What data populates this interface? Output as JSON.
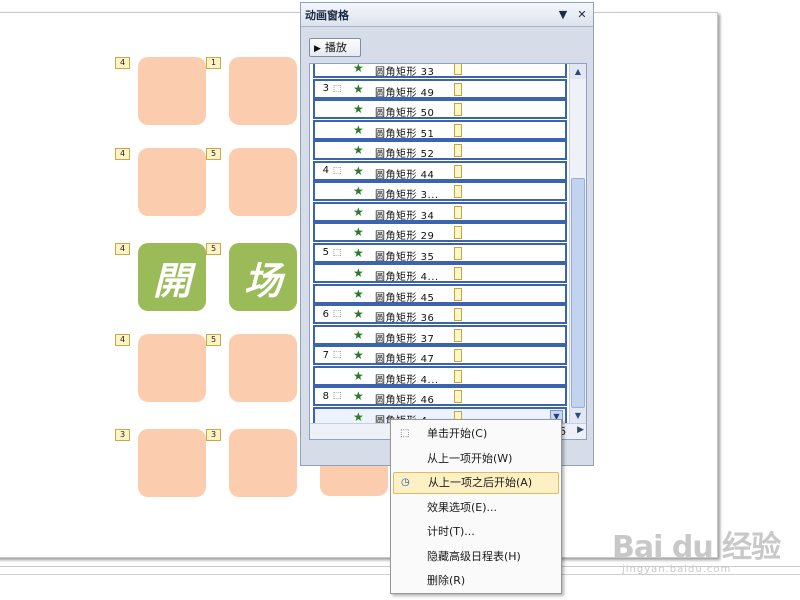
{
  "slide": {
    "badges": [
      "4",
      "1",
      "4",
      "5",
      "4",
      "5",
      "4",
      "5",
      "3",
      "3"
    ],
    "green_tiles": [
      "開",
      "场"
    ]
  },
  "pane": {
    "title": "动画窗格",
    "dropdown_arrow": "▼",
    "close": "✕",
    "play_label": "播放",
    "rows": [
      {
        "num": "",
        "label": "圆角矩形 33",
        "mouse": false
      },
      {
        "num": "3",
        "label": "圆角矩形 49",
        "mouse": true
      },
      {
        "num": "",
        "label": "圆角矩形 50",
        "mouse": false
      },
      {
        "num": "",
        "label": "圆角矩形 51",
        "mouse": false
      },
      {
        "num": "",
        "label": "圆角矩形 52",
        "mouse": false
      },
      {
        "num": "4",
        "label": "圆角矩形 44",
        "mouse": true
      },
      {
        "num": "",
        "label": "圆角矩形 3...",
        "mouse": false
      },
      {
        "num": "",
        "label": "圆角矩形 34",
        "mouse": false
      },
      {
        "num": "",
        "label": "圆角矩形 29",
        "mouse": false
      },
      {
        "num": "5",
        "label": "圆角矩形 35",
        "mouse": true
      },
      {
        "num": "",
        "label": "圆角矩形 4...",
        "mouse": false
      },
      {
        "num": "",
        "label": "圆角矩形 45",
        "mouse": false
      },
      {
        "num": "6",
        "label": "圆角矩形 36",
        "mouse": true
      },
      {
        "num": "",
        "label": "圆角矩形 37",
        "mouse": false
      },
      {
        "num": "7",
        "label": "圆角矩形 47",
        "mouse": true
      },
      {
        "num": "",
        "label": "圆角矩形 4...",
        "mouse": false
      },
      {
        "num": "8",
        "label": "圆角矩形 46",
        "mouse": true
      },
      {
        "num": "",
        "label": "圆角矩形 4...",
        "mouse": false,
        "selected": true
      }
    ],
    "hscroll_value": "6"
  },
  "menu": {
    "items": [
      {
        "label": "单击开始(C)",
        "icon": "mouse-icon"
      },
      {
        "label": "从上一项开始(W)",
        "icon": ""
      },
      {
        "label": "从上一项之后开始(A)",
        "icon": "clock-icon",
        "highlighted": true
      },
      {
        "label": "效果选项(E)...",
        "icon": ""
      },
      {
        "label": "计时(T)...",
        "icon": ""
      },
      {
        "label": "隐藏高级日程表(H)",
        "icon": ""
      },
      {
        "label": "删除(R)",
        "icon": ""
      }
    ]
  },
  "watermark": {
    "logo": "Bai du 经验",
    "url": "jingyan.baidu.com"
  }
}
